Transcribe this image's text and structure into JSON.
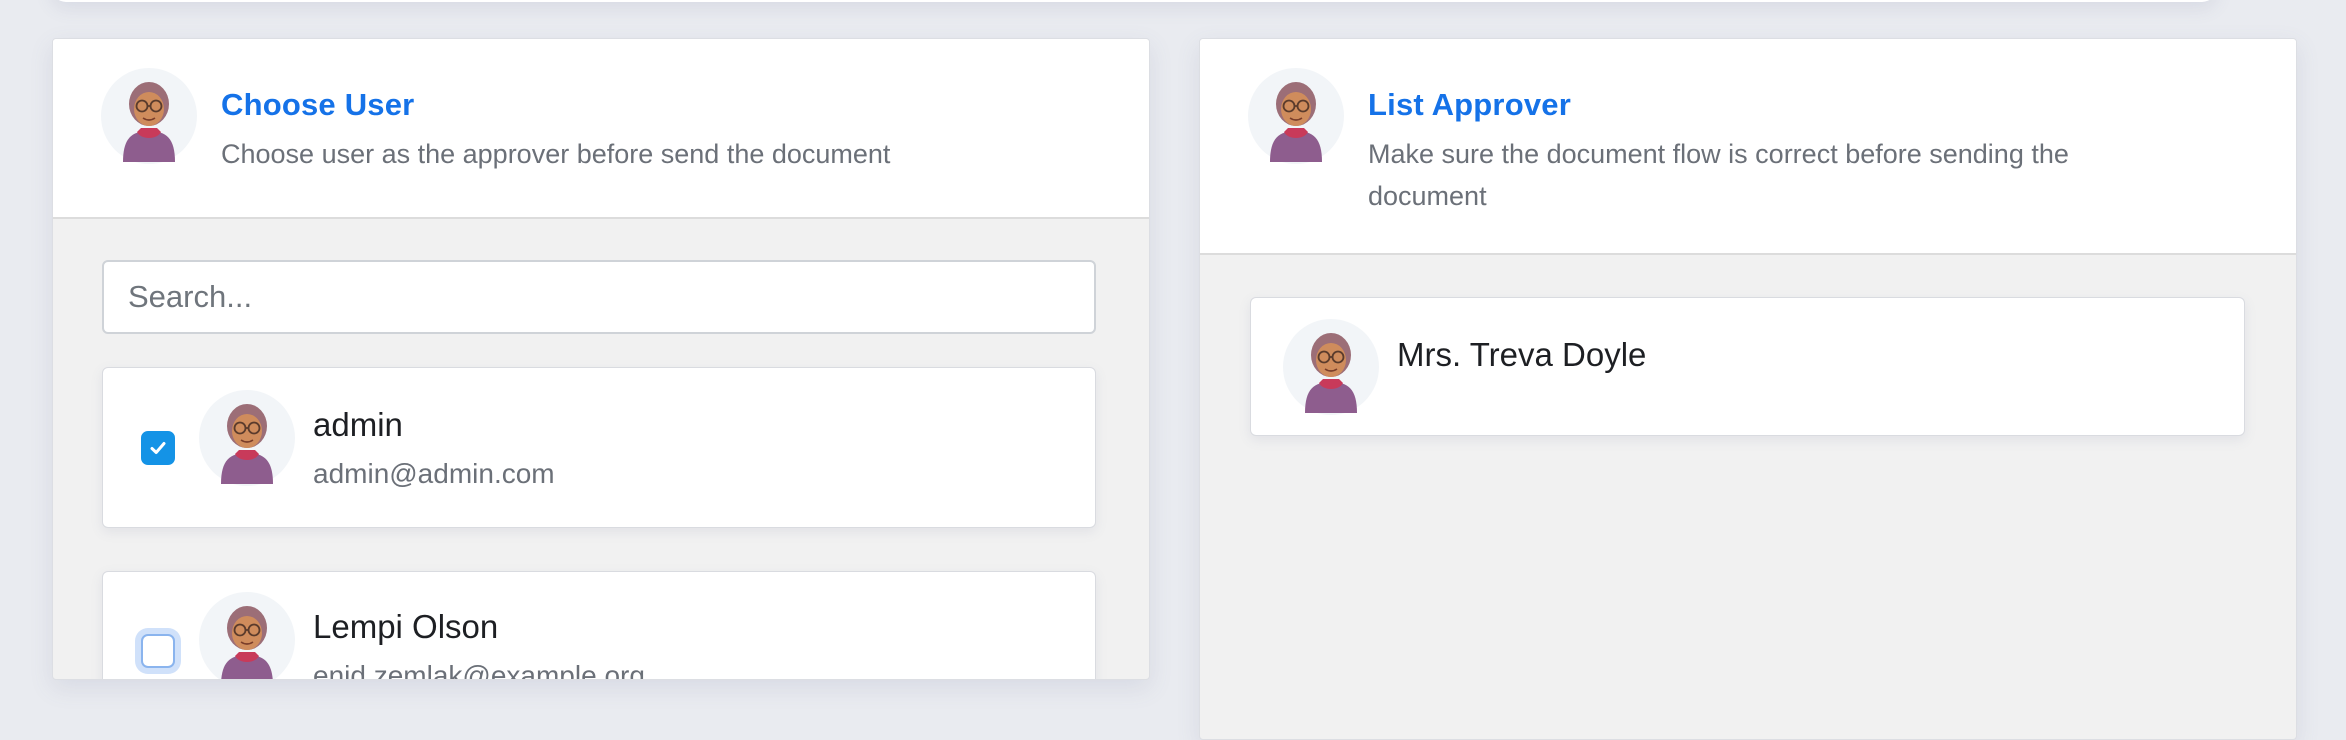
{
  "left_panel": {
    "title": "Choose User",
    "subtitle": "Choose user as the approver before send the document",
    "search": {
      "placeholder": "Search...",
      "value": ""
    },
    "users": [
      {
        "name": "admin",
        "email": "admin@admin.com",
        "checked": true
      },
      {
        "name": "Lempi Olson",
        "email": "enid.zemlak@example.org",
        "checked": false
      }
    ]
  },
  "right_panel": {
    "title": "List Approver",
    "subtitle": "Make sure the document flow is correct before sending the document",
    "approvers": [
      {
        "name": "Mrs. Treva Doyle"
      }
    ]
  },
  "icons": {
    "avatar": "avatar-icon",
    "checkbox_checked": "check-icon"
  },
  "colors": {
    "accent": "#1572e8",
    "checkbox": "#1493e6",
    "page_background": "#e9ebf0",
    "panel_body": "#f1f1f1"
  }
}
